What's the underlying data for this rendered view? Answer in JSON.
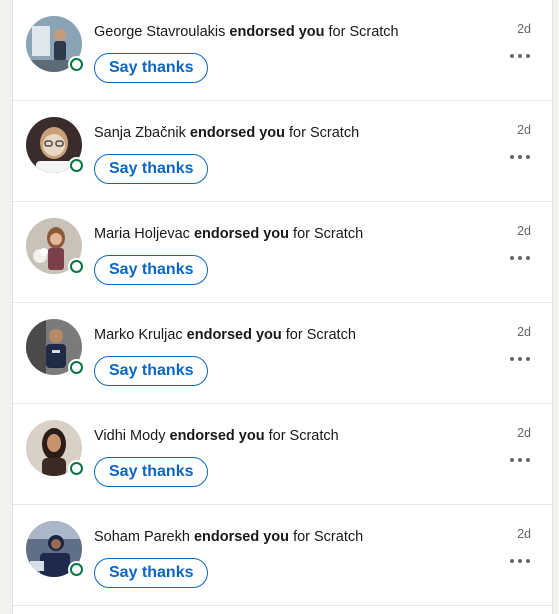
{
  "notifications": [
    {
      "name": "George Stavroulakis",
      "action": "endorsed you",
      "suffix": "for Scratch",
      "time": "2d",
      "button": "Say thanks",
      "avatar_bg": "#8aa3b5",
      "avatar_fg": "#2e3a4a"
    },
    {
      "name": "Sanja Zbačnik",
      "action": "endorsed you",
      "suffix": "for Scratch",
      "time": "2d",
      "button": "Say thanks",
      "avatar_bg": "#3a2c2a",
      "avatar_fg": "#e9d8c6"
    },
    {
      "name": "Maria Holjevac",
      "action": "endorsed you",
      "suffix": "for Scratch",
      "time": "2d",
      "button": "Say thanks",
      "avatar_bg": "#c9c2b6",
      "avatar_fg": "#7a3f48"
    },
    {
      "name": "Marko Kruljac",
      "action": "endorsed you",
      "suffix": "for Scratch",
      "time": "2d",
      "button": "Say thanks",
      "avatar_bg": "#7b7b7b",
      "avatar_fg": "#1f2b46"
    },
    {
      "name": "Vidhi Mody",
      "action": "endorsed you",
      "suffix": "for Scratch",
      "time": "2d",
      "button": "Say thanks",
      "avatar_bg": "#d9d1c6",
      "avatar_fg": "#2a1d17"
    },
    {
      "name": "Soham Parekh",
      "action": "endorsed you",
      "suffix": "for Scratch",
      "time": "2d",
      "button": "Say thanks",
      "avatar_bg": "#5f6f86",
      "avatar_fg": "#1a2340"
    }
  ],
  "colors": {
    "accent": "#0a66c2",
    "presence": "#057642",
    "muted_text": "#666666"
  },
  "icons": {
    "presence": "online-status-icon",
    "more": "more-options-icon"
  }
}
